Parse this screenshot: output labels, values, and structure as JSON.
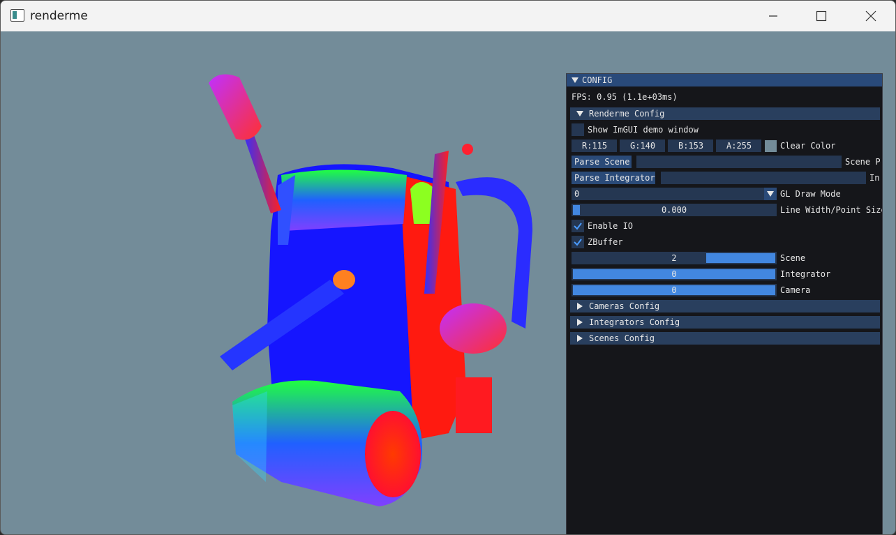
{
  "window": {
    "title": "renderme",
    "minimize_icon": "minimize-icon",
    "maximize_icon": "maximize-icon",
    "close_icon": "close-icon"
  },
  "colors": {
    "viewport_bg": "#738c99",
    "panel_bg": "#15161a",
    "title_bg": "#294a7a",
    "header_bg": "#293f5e",
    "frame_bg": "#253752",
    "accent": "#4287e0"
  },
  "config": {
    "title": "CONFIG",
    "fps": "FPS: 0.95 (1.1e+03ms)",
    "renderme_header": "Renderme Config",
    "show_demo_label": "Show ImGUI demo window",
    "show_demo_checked": false,
    "color": {
      "r": "R:115",
      "g": "G:140",
      "b": "B:153",
      "a": "A:255",
      "label": "Clear Color",
      "swatch": "#738c99"
    },
    "parse_scene_button": "Parse Scene",
    "scene_path_label": "Scene P",
    "scene_path_value": "",
    "parse_integrator_button": "Parse Integrator",
    "integrator_path_label": "In",
    "integrator_path_value": "",
    "draw_mode_value": "0",
    "draw_mode_label": "GL Draw Mode",
    "line_width_value": "0.000",
    "line_width_label": "Line Width/Point Size",
    "line_width_fraction": 0.0,
    "enable_io_label": "Enable IO",
    "enable_io_checked": true,
    "zbuffer_label": "ZBuffer",
    "zbuffer_checked": true,
    "scene_slider": {
      "value": "2",
      "label": "Scene",
      "fraction": 0.66
    },
    "integrator_slider": {
      "value": "0",
      "label": "Integrator",
      "fraction": 1.0
    },
    "camera_slider": {
      "value": "0",
      "label": "Camera",
      "fraction": 1.0
    },
    "cameras_header": "Cameras Config",
    "integrators_header": "Integrators Config",
    "scenes_header": "Scenes Config"
  }
}
